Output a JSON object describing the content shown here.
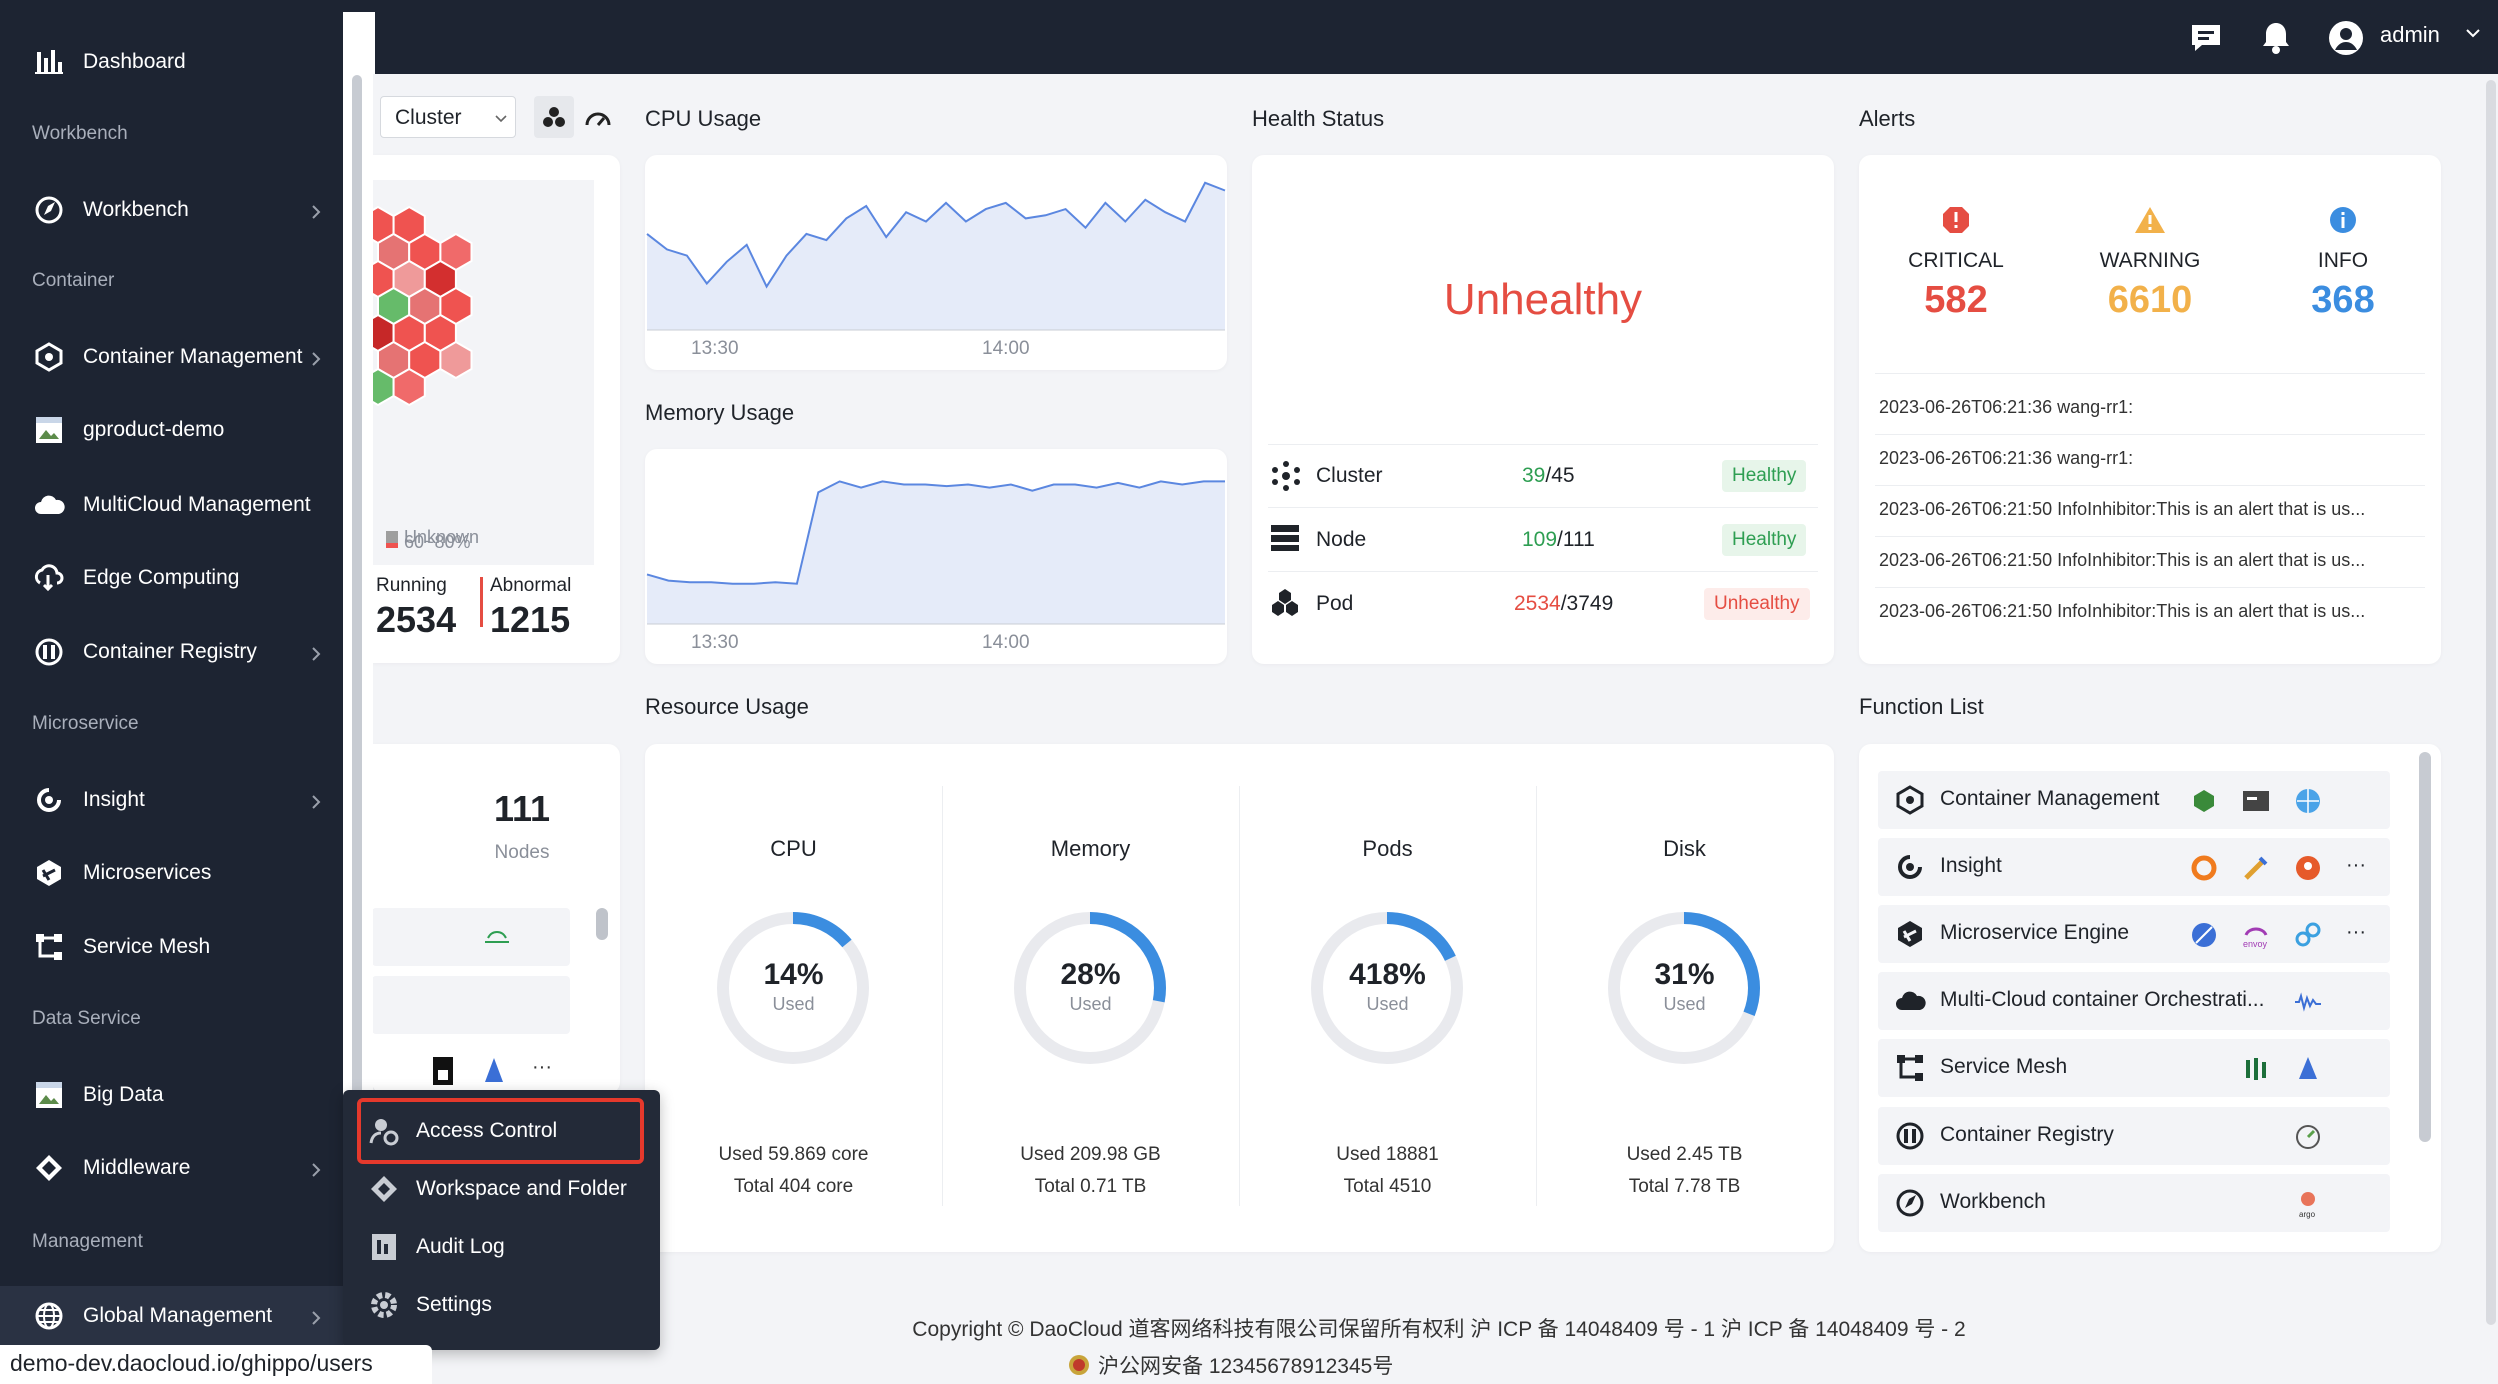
{
  "topbar": {
    "user": "admin",
    "icons": [
      "message-icon",
      "bell-icon",
      "user-avatar-icon"
    ]
  },
  "sidebar": {
    "items": [
      {
        "label": "Dashboard",
        "icon": "bar-chart-icon"
      },
      {
        "section": "Workbench"
      },
      {
        "label": "Workbench",
        "icon": "compass-icon",
        "arrow": true
      },
      {
        "section": "Container"
      },
      {
        "label": "Container Management",
        "icon": "hexagon-icon",
        "arrow": true
      },
      {
        "label": "gproduct-demo",
        "icon": "image-icon"
      },
      {
        "label": "MultiCloud Management",
        "icon": "cloud-icon"
      },
      {
        "label": "Edge Computing",
        "icon": "edge-icon"
      },
      {
        "label": "Container Registry",
        "icon": "registry-icon",
        "arrow": true
      },
      {
        "section": "Microservice"
      },
      {
        "label": "Insight",
        "icon": "insight-icon",
        "arrow": true
      },
      {
        "label": "Microservices",
        "icon": "microservice-icon"
      },
      {
        "label": "Service Mesh",
        "icon": "mesh-icon"
      },
      {
        "section": "Data Service"
      },
      {
        "label": "Big Data",
        "icon": "image-icon"
      },
      {
        "label": "Middleware",
        "icon": "middleware-icon",
        "arrow": true
      },
      {
        "section": "Management"
      },
      {
        "label": "Global Management",
        "icon": "globe-icon",
        "arrow": true
      }
    ]
  },
  "popup_menu": [
    {
      "label": "Access Control",
      "icon": "user-lock-icon"
    },
    {
      "label": "Workspace and Folder",
      "icon": "workspace-icon"
    },
    {
      "label": "Audit Log",
      "icon": "audit-icon"
    },
    {
      "label": "Settings",
      "icon": "gear-icon"
    }
  ],
  "status_url": "demo-dev.daocloud.io/ghippo/users",
  "cluster_panel": {
    "select": "Cluster",
    "legend": [
      "60~80%",
      "Unknown"
    ],
    "running_label": "Running",
    "running": "2534",
    "abnormal_label": "Abnormal",
    "abnormal": "1215",
    "nodes_value": "111",
    "nodes_label": "Nodes",
    "more": "···"
  },
  "cpu_usage": {
    "title": "CPU Usage",
    "x_ticks": [
      "13:30",
      "14:00"
    ]
  },
  "memory_usage": {
    "title": "Memory Usage",
    "x_ticks": [
      "13:30",
      "14:00"
    ]
  },
  "chart_data": [
    {
      "type": "area",
      "title": "CPU Usage",
      "x_ticks": [
        "13:30",
        "14:00"
      ],
      "values": [
        62,
        52,
        48,
        30,
        44,
        55,
        28,
        48,
        62,
        58,
        72,
        80,
        60,
        76,
        70,
        82,
        70,
        78,
        82,
        72,
        74,
        78,
        66,
        82,
        70,
        84,
        76,
        70,
        95,
        90
      ]
    },
    {
      "type": "area",
      "title": "Memory Usage",
      "x_ticks": [
        "13:30",
        "14:00"
      ],
      "values": [
        32,
        28,
        27,
        27,
        26,
        26,
        27,
        26,
        85,
        92,
        88,
        92,
        90,
        90,
        89,
        90,
        88,
        90,
        86,
        90,
        90,
        88,
        91,
        88,
        92,
        90,
        92,
        92
      ]
    }
  ],
  "health": {
    "title": "Health Status",
    "overall": "Unhealthy",
    "rows": [
      {
        "name": "Cluster",
        "icon": "cluster-icon",
        "ok": "39",
        "total": "/45",
        "status": "Healthy",
        "good": true
      },
      {
        "name": "Node",
        "icon": "node-icon",
        "ok": "109",
        "total": "/111",
        "status": "Healthy",
        "good": true
      },
      {
        "name": "Pod",
        "icon": "pod-icon",
        "ok": "2534",
        "total": "/3749",
        "status": "Unhealthy",
        "good": false
      }
    ]
  },
  "alerts": {
    "title": "Alerts",
    "levels": [
      {
        "label": "CRITICAL",
        "count": "582",
        "color": "#e54d42"
      },
      {
        "label": "WARNING",
        "count": "6610",
        "color": "#f2b14a"
      },
      {
        "label": "INFO",
        "count": "368",
        "color": "#3b8de0"
      }
    ],
    "items": [
      "2023-06-26T06:21:36 wang-rr1:",
      "2023-06-26T06:21:36 wang-rr1:",
      "2023-06-26T06:21:50 InfoInhibitor:This is an alert that is us...",
      "2023-06-26T06:21:50 InfoInhibitor:This is an alert that is us...",
      "2023-06-26T06:21:50 InfoInhibitor:This is an alert that is us..."
    ]
  },
  "resource": {
    "title": "Resource Usage",
    "items": [
      {
        "name": "CPU",
        "pct": "14%",
        "used_label": "Used",
        "value": 14,
        "used": "Used 59.869 core",
        "total": "Total 404 core"
      },
      {
        "name": "Memory",
        "pct": "28%",
        "used_label": "Used",
        "value": 28,
        "used": "Used 209.98 GB",
        "total": "Total 0.71 TB"
      },
      {
        "name": "Pods",
        "pct": "418%",
        "used_label": "Used",
        "value": 18,
        "used": "Used 18881",
        "total": "Total 4510"
      },
      {
        "name": "Disk",
        "pct": "31%",
        "used_label": "Used",
        "value": 31,
        "used": "Used 2.45 TB",
        "total": "Total 7.78 TB"
      }
    ]
  },
  "functions": {
    "title": "Function List",
    "items": [
      {
        "label": "Container Management",
        "icon": "hexagon-icon",
        "more": ""
      },
      {
        "label": "Insight",
        "icon": "insight-icon",
        "more": "···"
      },
      {
        "label": "Microservice Engine",
        "icon": "microservice-icon",
        "more": "···"
      },
      {
        "label": "Multi-Cloud container Orchestrati...",
        "icon": "cloud-icon",
        "more": ""
      },
      {
        "label": "Service Mesh",
        "icon": "mesh-icon",
        "more": ""
      },
      {
        "label": "Container Registry",
        "icon": "registry-icon",
        "more": ""
      },
      {
        "label": "Workbench",
        "icon": "compass-icon",
        "more": ""
      }
    ],
    "app_icon_text": "envoy"
  },
  "footer": {
    "line1": "Copyright © DaoCloud 道客网络科技有限公司保留所有权利  沪 ICP 备 14048409 号 - 1  沪 ICP 备 14048409 号 - 2",
    "line2": "沪公网安备 12345678912345号"
  }
}
